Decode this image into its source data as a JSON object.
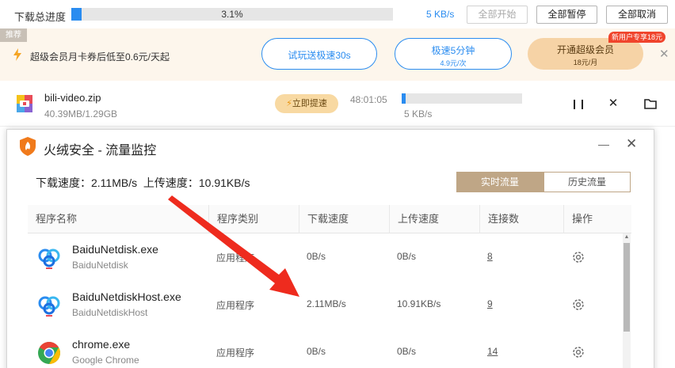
{
  "topbar": {
    "title": "下载总进度",
    "progress_pct": "3.1%",
    "progress_value": 0.031,
    "speed": "5 KB/s",
    "btn_start_all": "全部开始",
    "btn_pause_all": "全部暂停",
    "btn_cancel_all": "全部取消"
  },
  "promo": {
    "tag": "推荐",
    "text": "超级会员月卡券后低至0.6元/天起",
    "pill_trial": "试玩送极速30s",
    "pill_speed_main": "极速5分钟",
    "pill_speed_sub": "4.9元/次",
    "pill_vip_main": "开通超级会员",
    "pill_vip_sub": "18元/月",
    "new_user_badge": "新用户专享18元",
    "close_icon": "close-icon"
  },
  "download": {
    "filename": "bili-video.zip",
    "size": "40.39MB/1.29GB",
    "boost_label": "立即提速",
    "time_left": "48:01:05",
    "progress_value": 0.031,
    "speed": "5 KB/s"
  },
  "dialog": {
    "title": "火绒安全 - 流量监控",
    "summary_download_label": "下载速度：",
    "summary_download_value": "2.11MB/s",
    "summary_upload_label": "上传速度：",
    "summary_upload_value": "10.91KB/s",
    "tab_realtime": "实时流量",
    "tab_history": "历史流量",
    "columns": [
      "程序名称",
      "程序类别",
      "下载速度",
      "上传速度",
      "连接数",
      "操作"
    ],
    "rows": [
      {
        "name": "BaiduNetdisk.exe",
        "sub": "BaiduNetdisk",
        "type": "应用程序",
        "down": "0B/s",
        "up": "0B/s",
        "conn": "8",
        "icon": "baidu-netdisk-icon"
      },
      {
        "name": "BaiduNetdiskHost.exe",
        "sub": "BaiduNetdiskHost",
        "type": "应用程序",
        "down": "2.11MB/s",
        "up": "10.91KB/s",
        "conn": "9",
        "icon": "baidu-netdisk-icon"
      },
      {
        "name": "chrome.exe",
        "sub": "Google Chrome",
        "type": "应用程序",
        "down": "0B/s",
        "up": "0B/s",
        "conn": "14",
        "icon": "chrome-icon"
      }
    ]
  },
  "colors": {
    "accent_blue": "#2a8cf0",
    "tab_active": "#bfa686",
    "annotation_arrow": "#ee2b1e",
    "promo_bg": "#fdf6ec"
  }
}
